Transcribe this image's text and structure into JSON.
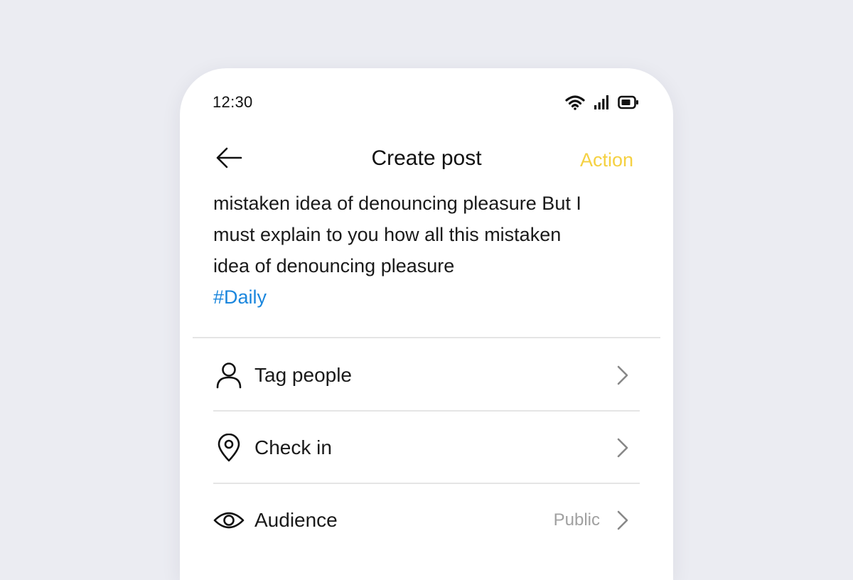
{
  "status_bar": {
    "time": "12:30",
    "icons": [
      "wifi-icon",
      "cellular-signal-icon",
      "battery-icon"
    ]
  },
  "nav": {
    "back_icon": "arrow-left-icon",
    "title": "Create post",
    "action_label": "Action"
  },
  "post": {
    "lines": [
      "mistaken idea of denouncing pleasure But I",
      "must explain to you how all this mistaken",
      "idea of denouncing pleasure"
    ],
    "hashtag": "#Daily"
  },
  "options": [
    {
      "icon": "user-icon",
      "label": "Tag people",
      "value": ""
    },
    {
      "icon": "location-pin-icon",
      "label": "Check in",
      "value": ""
    },
    {
      "icon": "eye-icon",
      "label": "Audience",
      "value": "Public"
    }
  ],
  "colors": {
    "background": "#ebecf2",
    "card": "#ffffff",
    "action": "#f5d142",
    "hashtag": "#1a86dd",
    "divider": "#e5e5e5",
    "secondary_text": "#a0a0a0"
  }
}
